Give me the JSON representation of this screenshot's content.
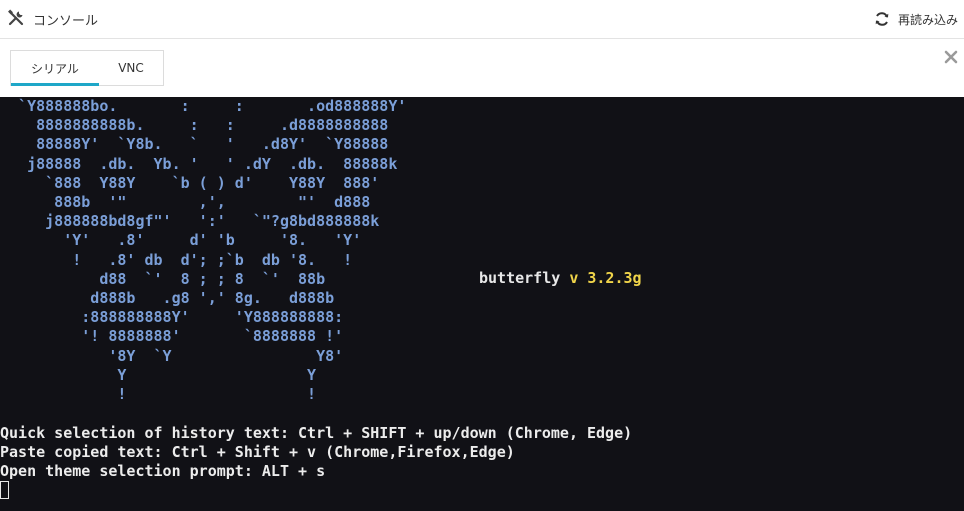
{
  "header": {
    "title": "コンソール",
    "reload_label": "再読み込み"
  },
  "tabs": [
    {
      "label": "シリアル",
      "active": true
    },
    {
      "label": "VNC",
      "active": false
    }
  ],
  "terminal": {
    "art_lines": [
      "  `Y888888bo.       :     :       .od888888Y'",
      "    8888888888b.     :   :     .d8888888888",
      "    88888Y'  `Y8b.   `   '   .d8Y'  `Y88888",
      "   j88888  .db.  Yb. '   ' .dY  .db.  88888k",
      "     `888  Y88Y    `b ( ) d'    Y88Y  888'",
      "      888b  '\"        ,',        \"'  d888",
      "     j888888bd8gf\"'   ':'   `\"?g8bd888888k",
      "       'Y'   .8'     d' 'b     '8.   'Y'",
      "        !   .8' db  d'; ;`b  db '8.   !",
      "           d88  `'  8 ; ; 8  `'  88b",
      "          d888b   .g8 ',' 8g.   d888b",
      "         :888888888Y'     'Y888888888:",
      "         '! 8888888'       `8888888 !'",
      "            '8Y  `Y                Y8'",
      "             Y                    Y",
      "             !                    !"
    ],
    "brand_name": "butterfly",
    "brand_v": "v",
    "brand_version": "3.2.3g",
    "help_lines": [
      "Quick selection of history text: Ctrl + SHIFT + up/down (Chrome, Edge)",
      "Paste copied text: Ctrl + Shift + v (Chrome,Firefox,Edge)",
      "Open theme selection prompt: ALT + s"
    ]
  },
  "colors": {
    "terminal_bg": "#111116",
    "art_blue": "#7b9fd8",
    "version_yellow": "#f0d44a",
    "tab_accent": "#1ea7c8"
  }
}
